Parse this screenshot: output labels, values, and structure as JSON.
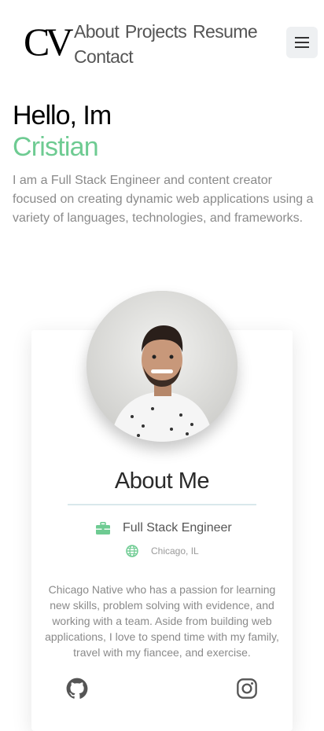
{
  "header": {
    "logo_text": "CV",
    "nav": [
      "About",
      "Projects",
      "Resume",
      "Contact"
    ]
  },
  "hero": {
    "greeting": "Hello, Im",
    "name": "Cristian",
    "intro": "I am a Full Stack Engineer and content creator focused on creating dynamic web applications using a variety of languages, technologies, and frameworks."
  },
  "about": {
    "title": "About Me",
    "role": "Full Stack Engineer",
    "location": "Chicago, IL",
    "bio": "Chicago Native who has a passion for learning new skills, problem solving with evidence, and working with a team. Aside from building web applications, I love to spend time with my family, travel with my fiancee, and exercise."
  },
  "icons": {
    "role": "briefcase-icon",
    "location": "globe-icon",
    "social": [
      "github-icon",
      "instagram-icon"
    ],
    "menu": "hamburger-menu-icon"
  },
  "colors": {
    "accent": "#6ecb92",
    "text_muted": "#8a8a8a",
    "menu_bg": "#eef0f2"
  }
}
